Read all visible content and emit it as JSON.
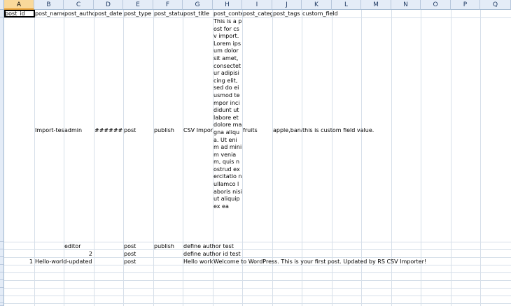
{
  "columns": [
    "A",
    "B",
    "C",
    "D",
    "E",
    "F",
    "G",
    "H",
    "I",
    "J",
    "K",
    "L",
    "M",
    "N",
    "O",
    "P",
    "Q"
  ],
  "selected_column": "A",
  "header_row": [
    "post_id",
    "post_name",
    "post_autho",
    "post_date",
    "post_type",
    "post_status",
    "post_title",
    "post_conte",
    "post_categ",
    "post_tags",
    "custom_field"
  ],
  "row2": {
    "post_name": "Import-tes",
    "post_author": "admin",
    "post_date": "########",
    "post_type": "post",
    "post_status": "publish",
    "post_title": "CSV Impor",
    "post_content": "This is a post for csv import. Lorem ipsum dolor sit amet, consectet ur adipisicing elit, sed do eiusmod tempor incididunt ut labore et dolore magna aliqua. Ut enim ad minim veniam, quis nostrud exercitatio n ullamco laboris nisi ut aliquip ex ea",
    "post_category": "fruits",
    "post_tags": "apple,banar",
    "custom_field": "this is custom field value."
  },
  "row3": {
    "post_author": "editor",
    "post_type": "post",
    "post_status": "publish",
    "post_title": "define author test"
  },
  "row4": {
    "post_author": "2",
    "post_type": "post",
    "post_title": "define author id test"
  },
  "row5": {
    "post_id": "1",
    "post_name": "Hello-world-updated",
    "post_type": "post",
    "post_title": "Hello world",
    "post_content": "Welcome to WordPress. This is your first post. Updated by RS CSV Importer!"
  }
}
